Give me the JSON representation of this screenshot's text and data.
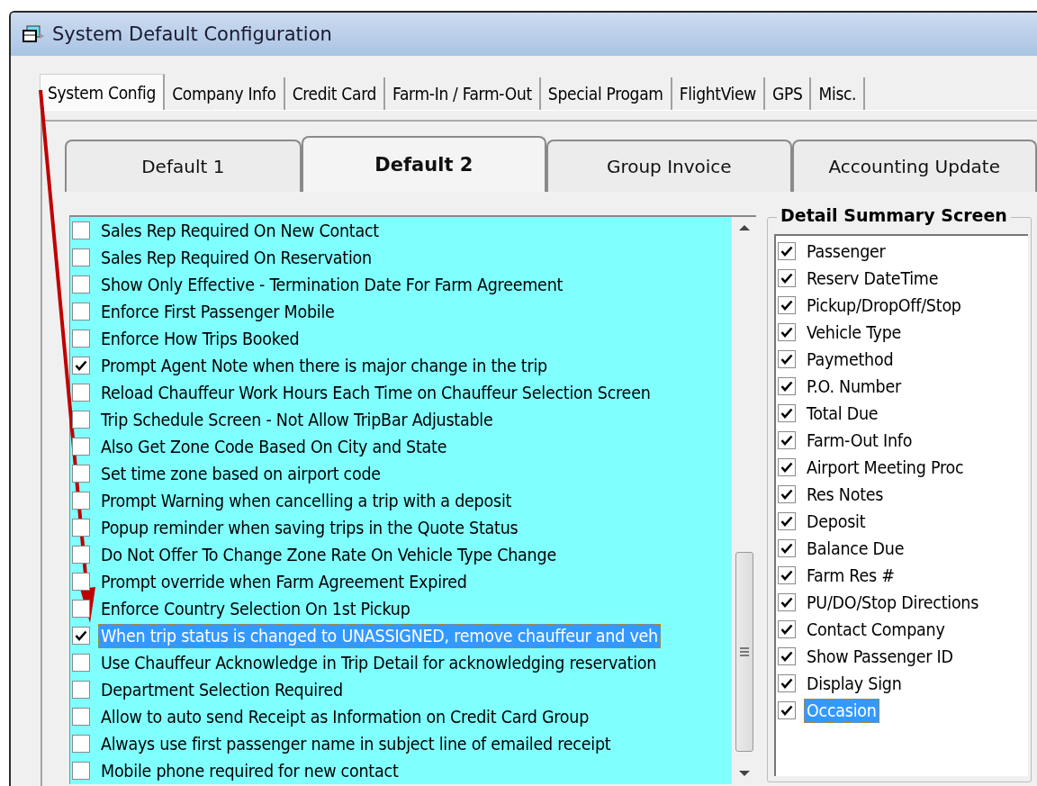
{
  "window": {
    "title": "System Default Configuration"
  },
  "tabs": [
    {
      "label": "System Config",
      "selected": true
    },
    {
      "label": "Company Info",
      "selected": false
    },
    {
      "label": "Credit Card",
      "selected": false
    },
    {
      "label": "Farm-In / Farm-Out",
      "selected": false
    },
    {
      "label": "Special Progam",
      "selected": false
    },
    {
      "label": "FlightView",
      "selected": false
    },
    {
      "label": "GPS",
      "selected": false
    },
    {
      "label": "Misc.",
      "selected": false
    }
  ],
  "subtabs": [
    {
      "label": "Default 1",
      "selected": false
    },
    {
      "label": "Default 2",
      "selected": true
    },
    {
      "label": "Group Invoice",
      "selected": false
    },
    {
      "label": "Accounting Update",
      "selected": false
    }
  ],
  "options": [
    {
      "label": "Sales Rep Required On New Contact",
      "checked": false,
      "selected": false
    },
    {
      "label": "Sales Rep Required On Reservation",
      "checked": false,
      "selected": false
    },
    {
      "label": "Show Only Effective - Termination Date For Farm Agreement",
      "checked": false,
      "selected": false
    },
    {
      "label": "Enforce First Passenger Mobile",
      "checked": false,
      "selected": false
    },
    {
      "label": "Enforce How Trips Booked",
      "checked": false,
      "selected": false
    },
    {
      "label": "Prompt Agent Note when there is major change in the trip",
      "checked": true,
      "selected": false
    },
    {
      "label": "Reload Chauffeur Work Hours Each Time on Chauffeur Selection Screen",
      "checked": false,
      "selected": false
    },
    {
      "label": "Trip Schedule Screen - Not Allow TripBar Adjustable",
      "checked": false,
      "selected": false
    },
    {
      "label": "Also Get Zone Code Based On City and State",
      "checked": false,
      "selected": false
    },
    {
      "label": "Set time zone based on airport code",
      "checked": false,
      "selected": false
    },
    {
      "label": "Prompt Warning when cancelling a trip with a deposit",
      "checked": false,
      "selected": false
    },
    {
      "label": "Popup reminder when saving trips in the Quote Status",
      "checked": false,
      "selected": false
    },
    {
      "label": "Do Not Offer To Change Zone Rate On Vehicle Type Change",
      "checked": false,
      "selected": false
    },
    {
      "label": "Prompt override when Farm Agreement Expired",
      "checked": false,
      "selected": false
    },
    {
      "label": "Enforce Country Selection On 1st Pickup",
      "checked": false,
      "selected": false
    },
    {
      "label": "When trip status is changed to UNASSIGNED, remove chauffeur and veh",
      "checked": true,
      "selected": true
    },
    {
      "label": "Use Chauffeur Acknowledge in Trip Detail for acknowledging reservation",
      "checked": false,
      "selected": false
    },
    {
      "label": "Department Selection Required",
      "checked": false,
      "selected": false
    },
    {
      "label": "Allow to auto send Receipt as Information on Credit Card Group",
      "checked": false,
      "selected": false
    },
    {
      "label": "Always use first passenger name in subject line of emailed receipt",
      "checked": false,
      "selected": false
    },
    {
      "label": "Mobile phone required for new contact",
      "checked": false,
      "selected": false
    }
  ],
  "detail_summary": {
    "title": "Detail Summary Screen",
    "items": [
      {
        "label": "Passenger",
        "checked": true,
        "selected": false
      },
      {
        "label": "Reserv DateTime",
        "checked": true,
        "selected": false
      },
      {
        "label": "Pickup/DropOff/Stop",
        "checked": true,
        "selected": false
      },
      {
        "label": "Vehicle Type",
        "checked": true,
        "selected": false
      },
      {
        "label": "Paymethod",
        "checked": true,
        "selected": false
      },
      {
        "label": "P.O. Number",
        "checked": true,
        "selected": false
      },
      {
        "label": "Total Due",
        "checked": true,
        "selected": false
      },
      {
        "label": "Farm-Out Info",
        "checked": true,
        "selected": false
      },
      {
        "label": "Airport Meeting Proc",
        "checked": true,
        "selected": false
      },
      {
        "label": "Res Notes",
        "checked": true,
        "selected": false
      },
      {
        "label": "Deposit",
        "checked": true,
        "selected": false
      },
      {
        "label": "Balance Due",
        "checked": true,
        "selected": false
      },
      {
        "label": "Farm Res #",
        "checked": true,
        "selected": false
      },
      {
        "label": "PU/DO/Stop Directions",
        "checked": true,
        "selected": false
      },
      {
        "label": "Contact Company",
        "checked": true,
        "selected": false
      },
      {
        "label": "Show Passenger ID",
        "checked": true,
        "selected": false
      },
      {
        "label": "Display Sign",
        "checked": true,
        "selected": false
      },
      {
        "label": "Occasion",
        "checked": true,
        "selected": true
      }
    ]
  }
}
